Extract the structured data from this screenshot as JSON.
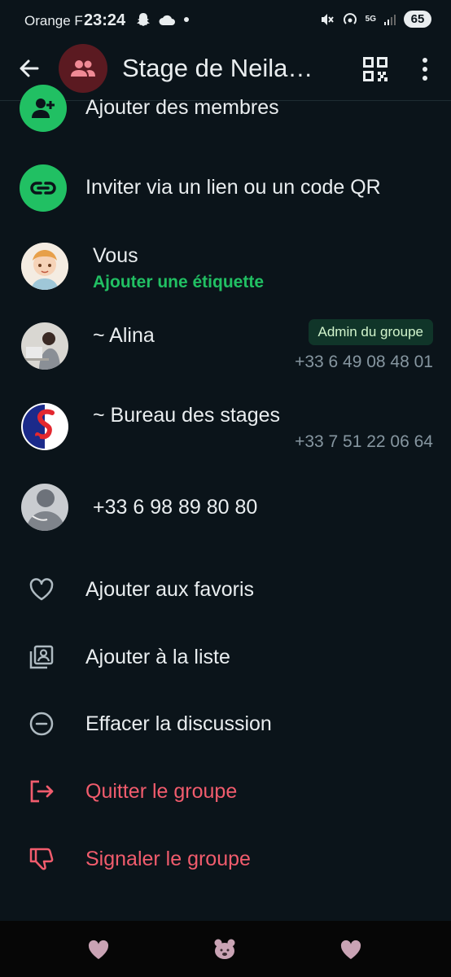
{
  "status_bar": {
    "carrier": "Orange F",
    "time": "23:24",
    "network": "5G",
    "battery": "65"
  },
  "header": {
    "title": "Stage de Neila…",
    "avatar_icon": "group-icon"
  },
  "actions": [
    {
      "label": "Ajouter des membres",
      "icon": "add-person-icon"
    },
    {
      "label": "Inviter via un lien ou un code QR",
      "icon": "link-icon"
    }
  ],
  "members": [
    {
      "name": "Vous",
      "subtitle": "Ajouter une étiquette"
    },
    {
      "name": "~ Alina",
      "badge": "Admin du groupe",
      "phone": "+33 6 49 08 48 01"
    },
    {
      "name": "~ Bureau des stages",
      "phone": "+33 7 51 22 06 64"
    },
    {
      "name": "+33 6 98 89 80 80"
    }
  ],
  "options": [
    {
      "label": "Ajouter aux favoris",
      "icon": "heart-icon",
      "danger": false
    },
    {
      "label": "Ajouter à la liste",
      "icon": "contact-list-icon",
      "danger": false
    },
    {
      "label": "Effacer la discussion",
      "icon": "minus-circle-icon",
      "danger": false
    },
    {
      "label": "Quitter le groupe",
      "icon": "exit-icon",
      "danger": true
    },
    {
      "label": "Signaler le groupe",
      "icon": "thumbs-down-icon",
      "danger": true
    }
  ],
  "colors": {
    "background": "#0b141a",
    "accent_green": "#21c063",
    "danger_red": "#f15c6d",
    "secondary_text": "#8696a0",
    "badge_bg": "#103529"
  }
}
